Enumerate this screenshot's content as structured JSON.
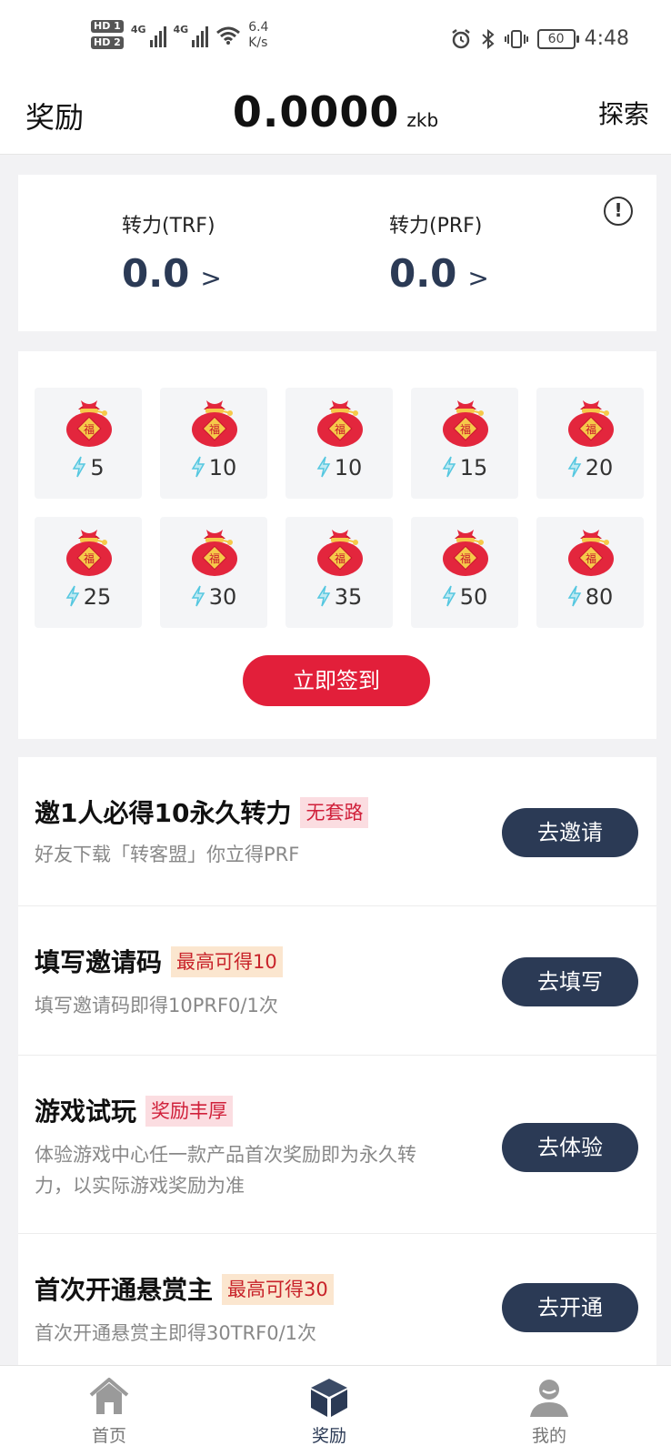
{
  "status_bar": {
    "hd1": "HD 1",
    "hd2": "HD 2",
    "net1": "4G",
    "net2": "4G",
    "speed_value": "6.4",
    "speed_unit": "K/s",
    "battery": "60",
    "time": "4:48"
  },
  "header": {
    "left_title": "奖励",
    "amount": "0.0000",
    "unit": "zkb",
    "right_link": "探索"
  },
  "balances": {
    "trf": {
      "title": "转力(TRF)",
      "value": "0.0",
      "arrow": ">"
    },
    "prf": {
      "title": "转力(PRF)",
      "value": "0.0",
      "arrow": ">"
    },
    "info_icon": "!"
  },
  "signin": {
    "bag_char": "福",
    "rewards": [
      "5",
      "10",
      "10",
      "15",
      "20",
      "25",
      "30",
      "35",
      "50",
      "80"
    ],
    "button_label": "立即签到"
  },
  "tasks": [
    {
      "title": "邀1人必得10永久转力",
      "tag": "无套路",
      "desc": "好友下载「转客盟」你立得PRF",
      "button": "去邀请"
    },
    {
      "title": "填写邀请码",
      "tag": "最高可得10",
      "desc": "填写邀请码即得10PRF0/1次",
      "button": "去填写"
    },
    {
      "title": "游戏试玩",
      "tag": "奖励丰厚",
      "desc": "体验游戏中心任一款产品首次奖励即为永久转力，以实际游戏奖励为准",
      "button": "去体验"
    },
    {
      "title": "首次开通悬赏主",
      "tag": "最高可得30",
      "desc": "首次开通悬赏主即得30TRF0/1次",
      "button": "去开通"
    }
  ],
  "bottom_nav": [
    {
      "label": "首页",
      "icon": "home-icon"
    },
    {
      "label": "奖励",
      "icon": "box-icon"
    },
    {
      "label": "我的",
      "icon": "user-icon"
    }
  ],
  "colors": {
    "accent_red": "#e21f3a",
    "navy": "#2b3a55",
    "bolt": "#55c7e0"
  }
}
